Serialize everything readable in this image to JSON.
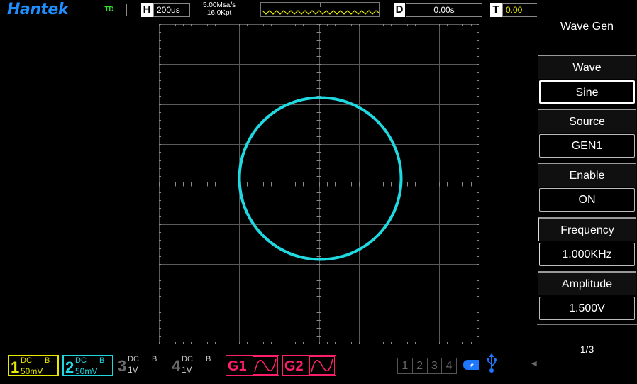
{
  "header": {
    "logo": "Hantek",
    "mode": "TD",
    "horizontal_letter": "H",
    "timebase": "200us",
    "sample_rate": "5.00Msa/s",
    "memory_depth": "16.0Kpt",
    "delay_letter": "D",
    "delay": "0.00s",
    "trigger_letter": "T",
    "trigger_level": "0.00"
  },
  "menu": {
    "title": "Wave Gen",
    "items": [
      {
        "label": "Wave",
        "value": "Sine"
      },
      {
        "label": "Source",
        "value": "GEN1"
      },
      {
        "label": "Enable",
        "value": "ON"
      },
      {
        "label": "Frequency",
        "value": "1.000KHz"
      },
      {
        "label": "Amplitude",
        "value": "1.500V"
      }
    ],
    "page": "1/3"
  },
  "channels": [
    {
      "number": "1",
      "coupling": "DC",
      "bandwidth": "B",
      "scale": "50mV",
      "color": "#e8e800"
    },
    {
      "number": "2",
      "coupling": "DC",
      "bandwidth": "B",
      "scale": "50mV",
      "color": "#20d8e0"
    },
    {
      "number": "3",
      "coupling": "DC",
      "bandwidth": "B",
      "scale": "1V",
      "color": "#6a6a6a"
    },
    {
      "number": "4",
      "coupling": "DC",
      "bandwidth": "B",
      "scale": "1V",
      "color": "#6a6a6a"
    }
  ],
  "generators": [
    {
      "label": "G1",
      "color": "#ff1e6a"
    },
    {
      "label": "G2",
      "color": "#ff1e6a"
    }
  ],
  "channel_select": [
    "1",
    "2",
    "3",
    "4"
  ],
  "status_icons": [
    "usb-storage-icon",
    "usb-icon"
  ],
  "trace": {
    "shape": "circle",
    "color": "#20d8e0",
    "mode": "XY"
  }
}
